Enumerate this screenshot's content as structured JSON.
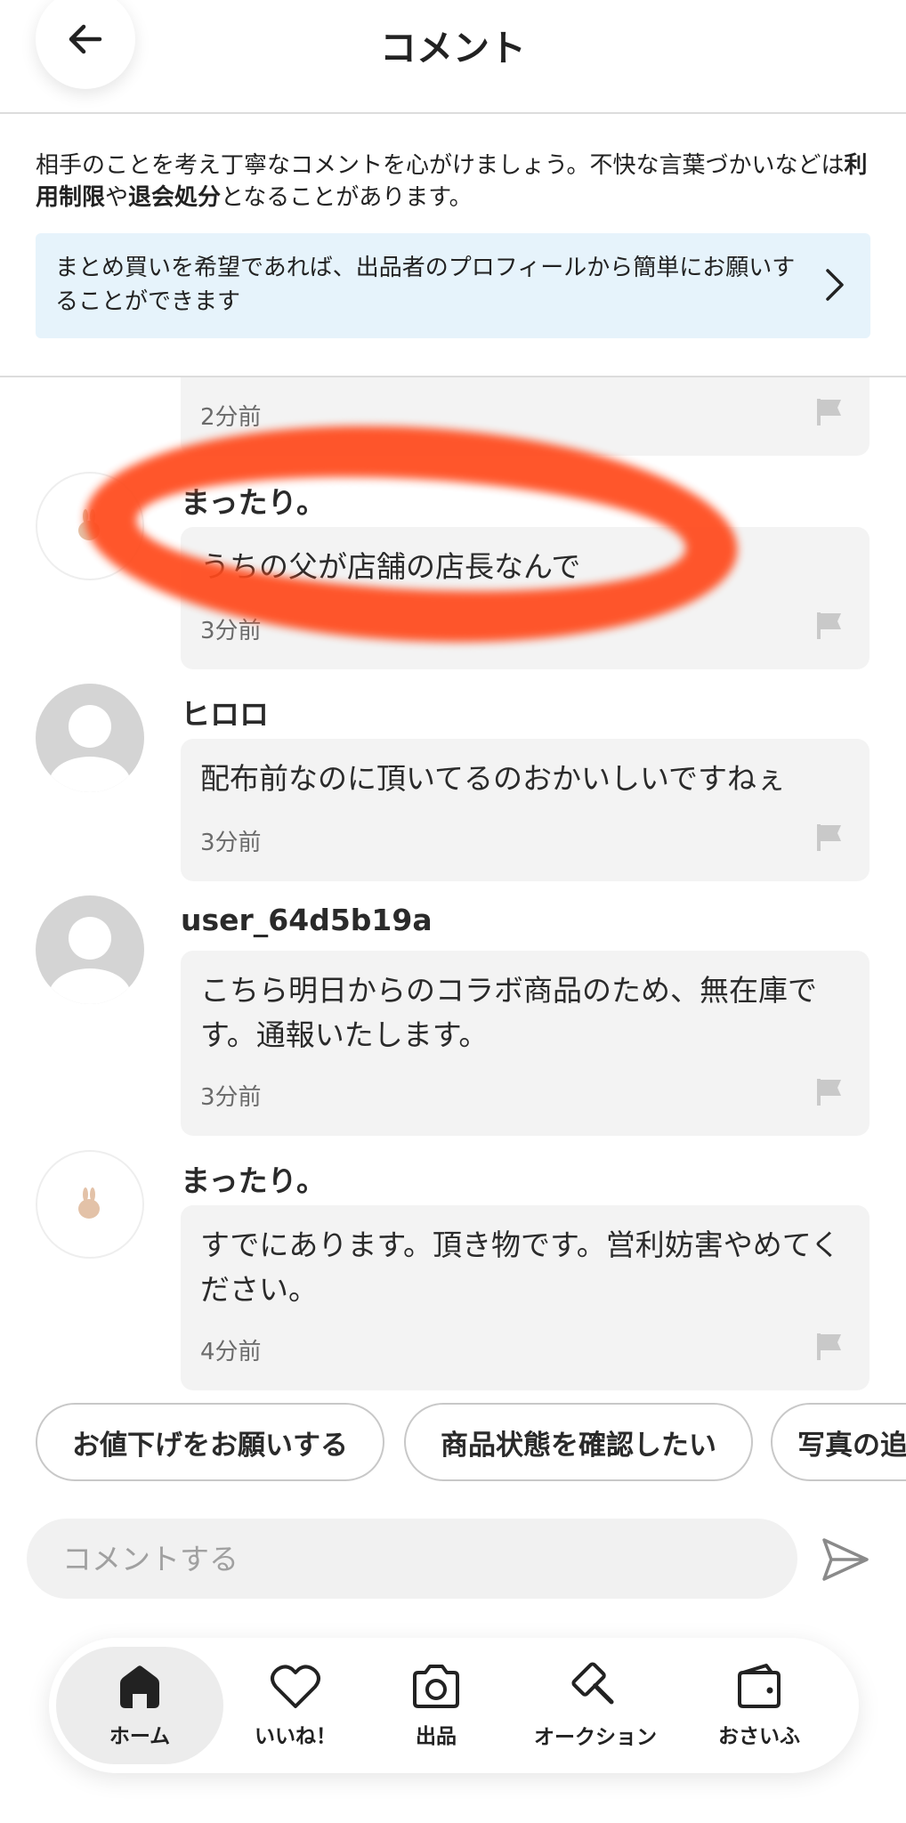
{
  "header": {
    "title": "コメント"
  },
  "notice": {
    "text_before": "相手のことを考え丁寧なコメントを心がけましょう。不快な言葉づかいなどは",
    "bold_1": "利用制限",
    "text_mid": "や",
    "bold_2": "退会処分",
    "text_after": "となることがあります。"
  },
  "banner": {
    "text": "まとめ買いを希望であれば、出品者のプロフィールから簡単にお願いすることができます"
  },
  "comments": [
    {
      "name": "",
      "text": "",
      "time": "2分前"
    },
    {
      "name": "まったり。",
      "text": "うちの父が店舗の店長なんで",
      "time": "3分前"
    },
    {
      "name": "ヒロロ",
      "text": "配布前なのに頂いてるのおかいしいですねぇ",
      "time": "3分前"
    },
    {
      "name": "user_64d5b19a",
      "text": "こちら明日からのコラボ商品のため、無在庫です。通報いたします。",
      "time": "3分前"
    },
    {
      "name": "まったり。",
      "text": "すでにあります。頂き物です。営利妨害やめてください。",
      "time": "4分前"
    }
  ],
  "quick_replies": [
    "お値下げをお願いする",
    "商品状態を確認したい",
    "写真の追加をお願いしたい"
  ],
  "comment_input": {
    "placeholder": "コメントする"
  },
  "nav": [
    {
      "label": "ホーム",
      "icon": "home-icon",
      "active": true
    },
    {
      "label": "いいね！",
      "icon": "heart-icon",
      "active": false
    },
    {
      "label": "出品",
      "icon": "camera-icon",
      "active": false
    },
    {
      "label": "オークション",
      "icon": "gavel-icon",
      "active": false
    },
    {
      "label": "おさいふ",
      "icon": "wallet-icon",
      "active": false
    }
  ],
  "colors": {
    "banner_bg": "#e6f3fb",
    "marker_red": "#ff4a1c",
    "bubble_bg": "#f3f3f3"
  }
}
